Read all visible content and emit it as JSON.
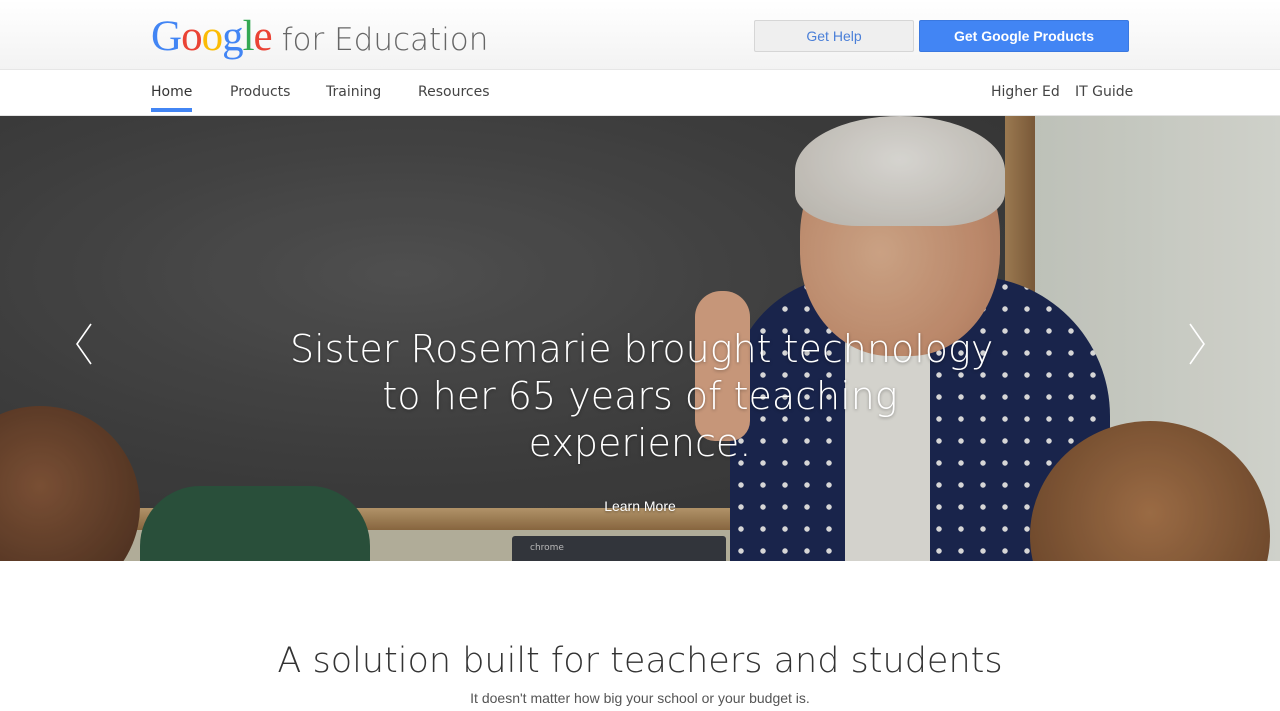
{
  "header": {
    "logo_google": "Google",
    "logo_suffix": "for Education",
    "get_help_label": "Get Help",
    "get_products_label": "Get Google Products"
  },
  "nav": {
    "left": [
      "Home",
      "Products",
      "Training",
      "Resources"
    ],
    "right": [
      "Higher Ed",
      "IT Guide"
    ],
    "active": "Home"
  },
  "hero": {
    "headline_lines": [
      "Sister Rosemarie brought technology",
      "to her 65 years of teaching",
      "experience."
    ],
    "cta_label": "Learn More",
    "laptop_text": "chrome",
    "prev_icon": "chevron-left-icon",
    "next_icon": "chevron-right-icon"
  },
  "section": {
    "title": "A solution built for teachers and students",
    "subtitle": "It doesn't matter how big your school or your budget is."
  },
  "colors": {
    "accent": "#4285f4",
    "google_blue": "#4285f4",
    "google_red": "#ea4335",
    "google_yellow": "#fbbc05",
    "google_green": "#34a853"
  }
}
